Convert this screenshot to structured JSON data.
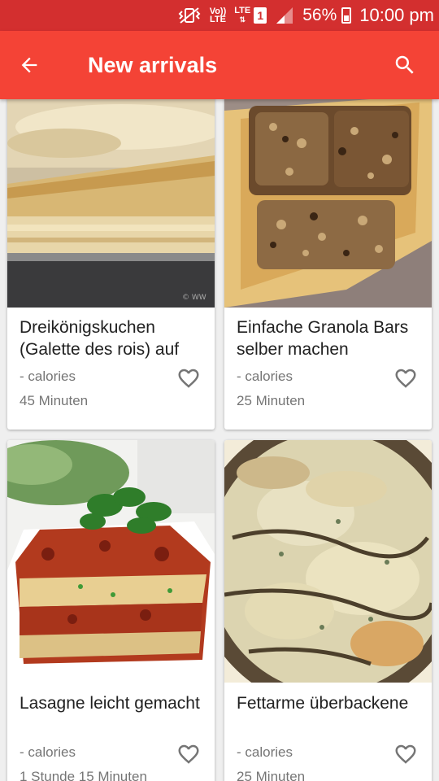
{
  "status_bar": {
    "volte_top": "Vo))",
    "volte_bottom": "LTE",
    "lte_label": "LTE",
    "sim_slot": "1",
    "battery": "56%",
    "battery_level": 0.56,
    "time": "10:00 pm",
    "icons": [
      "vibrate-icon",
      "signal-icon",
      "battery-icon"
    ]
  },
  "app_bar": {
    "title": "New arrivals",
    "back_icon": "arrow-left-icon",
    "search_icon": "search-icon"
  },
  "colors": {
    "status_bar": "#d32f2f",
    "app_bar": "#f44336",
    "background": "#efefef",
    "card": "#ffffff",
    "secondary_text": "#757575",
    "heart": "#757575"
  },
  "recipes": [
    {
      "name": "Dreikönigskuchen (Galette des rois) auf",
      "calories": "- calories",
      "duration": "45 Minuten",
      "image": "puff-pastry-cake-photo"
    },
    {
      "name": "Einfache Granola Bars selber machen",
      "calories": "- calories",
      "duration": "25 Minuten",
      "image": "granola-bars-photo"
    },
    {
      "name": "Lasagne leicht gemacht",
      "calories": "- calories",
      "duration": "1 Stunde 15 Minuten",
      "image": "lasagne-photo"
    },
    {
      "name": "Fettarme überbackene",
      "calories": "- calories",
      "duration": "25 Minuten",
      "image": "zucchini-gratin-photo"
    }
  ]
}
